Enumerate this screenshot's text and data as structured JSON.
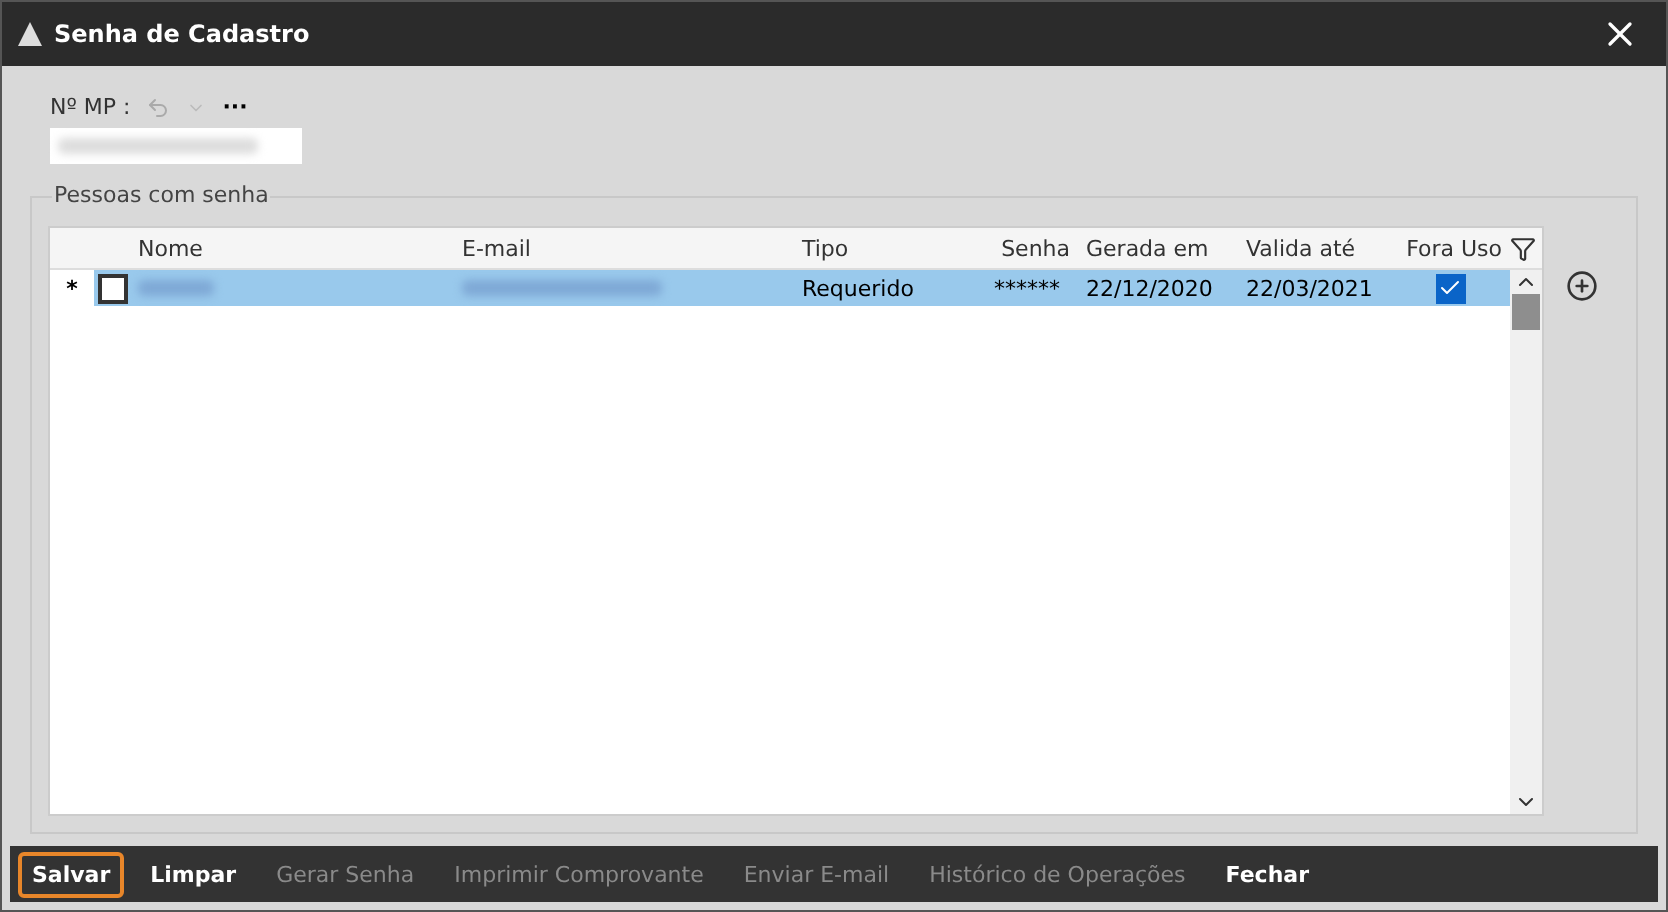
{
  "window": {
    "title": "Senha de Cadastro"
  },
  "mp_field": {
    "label": "Nº MP :",
    "more": "···"
  },
  "group": {
    "title": "Pessoas com senha"
  },
  "table": {
    "columns": [
      "Nome",
      "E-mail",
      "Tipo",
      "Senha",
      "Gerada em",
      "Valida até",
      "Fora Uso"
    ],
    "rows": [
      {
        "marker": "*",
        "checked": false,
        "selected": true,
        "tipo": "Requerido",
        "senha": "******",
        "gerada": "22/12/2020",
        "valida": "22/03/2021",
        "fora_uso": true
      }
    ]
  },
  "buttons": [
    {
      "label": "Salvar",
      "disabled": false,
      "focused": true
    },
    {
      "label": "Limpar",
      "disabled": false,
      "focused": false
    },
    {
      "label": "Gerar Senha",
      "disabled": true,
      "focused": false
    },
    {
      "label": "Imprimir Comprovante",
      "disabled": true,
      "focused": false
    },
    {
      "label": "Enviar E-mail",
      "disabled": true,
      "focused": false
    },
    {
      "label": "Histórico de Operações",
      "disabled": true,
      "focused": false
    },
    {
      "label": "Fechar",
      "disabled": false,
      "focused": false
    }
  ]
}
